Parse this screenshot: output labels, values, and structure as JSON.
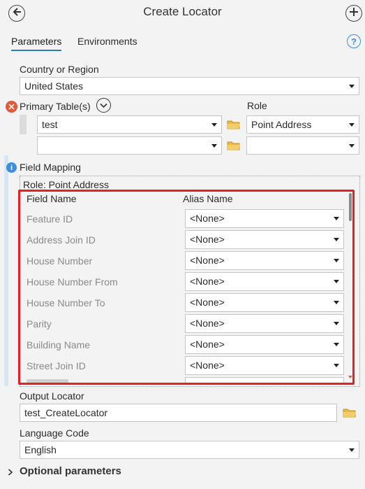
{
  "header": {
    "title": "Create Locator",
    "back_icon": "back-arrow-icon",
    "add_icon": "add-plus-icon"
  },
  "tabs": [
    {
      "label": "Parameters",
      "active": true
    },
    {
      "label": "Environments",
      "active": false
    }
  ],
  "help_label": "?",
  "country": {
    "label": "Country or Region",
    "value": "United States"
  },
  "primary_tables": {
    "label": "Primary Table(s)",
    "role_label": "Role",
    "rows": [
      {
        "table": "test",
        "role": "Point Address"
      },
      {
        "table": "",
        "role": ""
      }
    ]
  },
  "field_mapping": {
    "label": "Field Mapping",
    "role_text": "Role: Point Address",
    "col_field": "Field Name",
    "col_alias": "Alias Name",
    "rows": [
      {
        "field": "Feature ID",
        "alias": "<None>"
      },
      {
        "field": "Address Join ID",
        "alias": "<None>"
      },
      {
        "field": "House Number",
        "alias": "<None>"
      },
      {
        "field": "House Number From",
        "alias": "<None>"
      },
      {
        "field": "House Number To",
        "alias": "<None>"
      },
      {
        "field": "Parity",
        "alias": "<None>"
      },
      {
        "field": "Building Name",
        "alias": "<None>"
      },
      {
        "field": "Street Join ID",
        "alias": "<None>"
      }
    ]
  },
  "output_locator": {
    "label": "Output Locator",
    "value": "test_CreateLocator"
  },
  "language": {
    "label": "Language Code",
    "value": "English"
  },
  "optional": {
    "label": "Optional parameters"
  },
  "colors": {
    "accent": "#2b7bc4",
    "error": "#e05a3a",
    "info": "#3a8ee6",
    "highlight": "#e52222",
    "folder": "#e8b84a"
  }
}
